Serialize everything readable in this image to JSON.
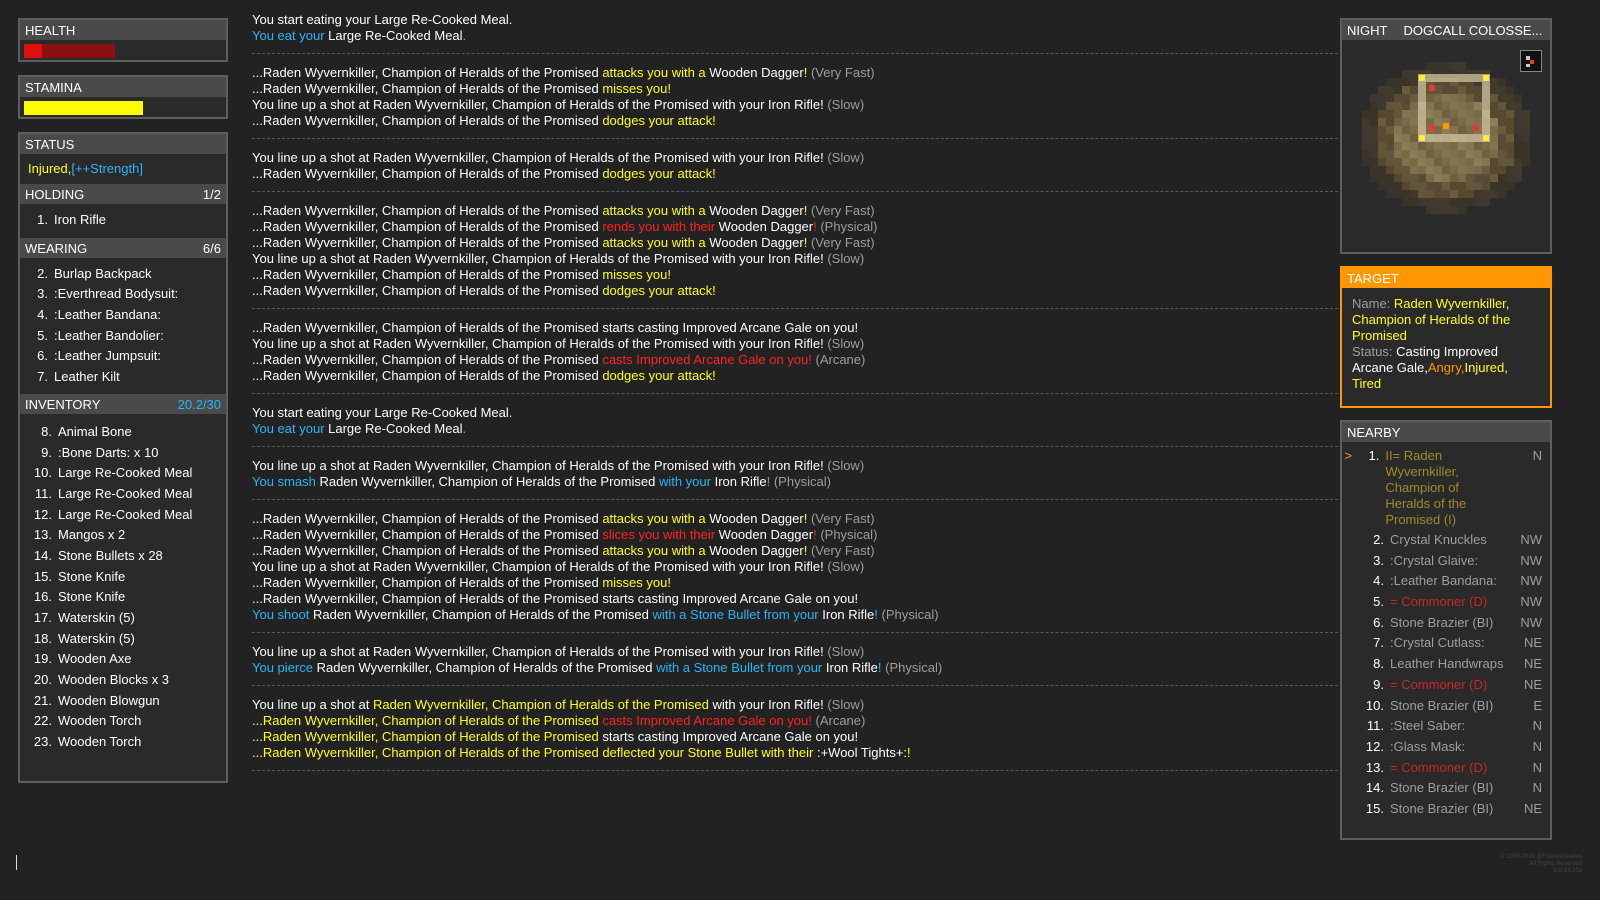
{
  "health": {
    "label": "HEALTH",
    "value": 0.09,
    "damage_shadow": 0.46
  },
  "stamina": {
    "label": "STAMINA",
    "value": 0.6
  },
  "status": {
    "label": "STATUS",
    "injured": "Injured,",
    "strength": "[++Strength]"
  },
  "holding": {
    "label": "HOLDING",
    "count": "1/2",
    "items": [
      {
        "n": "1.",
        "name": "Iron Rifle"
      }
    ]
  },
  "wearing": {
    "label": "WEARING",
    "count": "6/6",
    "items": [
      {
        "n": "2.",
        "name": "Burlap Backpack"
      },
      {
        "n": "3.",
        "name": ":Everthread Bodysuit:"
      },
      {
        "n": "4.",
        "name": ":Leather Bandana:"
      },
      {
        "n": "5.",
        "name": ":Leather Bandolier:"
      },
      {
        "n": "6.",
        "name": ":Leather Jumpsuit:"
      },
      {
        "n": "7.",
        "name": "Leather Kilt"
      }
    ]
  },
  "inventory": {
    "label": "INVENTORY",
    "count": "20.2/30",
    "items": [
      {
        "n": "8.",
        "name": "Animal Bone"
      },
      {
        "n": "9.",
        "name": ":Bone Darts: x 10"
      },
      {
        "n": "10.",
        "name": "Large Re-Cooked Meal"
      },
      {
        "n": "11.",
        "name": "Large Re-Cooked Meal"
      },
      {
        "n": "12.",
        "name": "Large Re-Cooked Meal"
      },
      {
        "n": "13.",
        "name": "Mangos x 2"
      },
      {
        "n": "14.",
        "name": "Stone Bullets x 28"
      },
      {
        "n": "15.",
        "name": "Stone Knife"
      },
      {
        "n": "16.",
        "name": "Stone Knife"
      },
      {
        "n": "17.",
        "name": "Waterskin (5)"
      },
      {
        "n": "18.",
        "name": "Waterskin (5)"
      },
      {
        "n": "19.",
        "name": "Wooden Axe"
      },
      {
        "n": "20.",
        "name": "Wooden Blocks x 3"
      },
      {
        "n": "21.",
        "name": "Wooden Blowgun"
      },
      {
        "n": "22.",
        "name": "Wooden Torch"
      },
      {
        "n": "23.",
        "name": "Wooden Torch"
      }
    ]
  },
  "log": [
    [
      [
        [
          "w",
          "You start eating your Large Re-Cooked Meal."
        ]
      ],
      [
        [
          "b",
          "You eat your "
        ],
        [
          "w",
          "Large Re-Cooked Meal"
        ],
        [
          "g",
          "."
        ]
      ]
    ],
    [
      [
        [
          "w",
          "...Raden Wyvernkiller, Champion of Heralds of the Promised "
        ],
        [
          "y",
          "attacks you with a "
        ],
        [
          "w",
          "Wooden Dagger"
        ],
        [
          "y",
          "!"
        ],
        [
          "g",
          " (Very Fast)"
        ]
      ],
      [
        [
          "w",
          "...Raden Wyvernkiller, Champion of Heralds of the Promised "
        ],
        [
          "y",
          "misses you!"
        ]
      ],
      [
        [
          "w",
          "You line up a shot at Raden Wyvernkiller, Champion of Heralds of the Promised with your Iron Rifle!"
        ],
        [
          "g",
          " (Slow)"
        ]
      ],
      [
        [
          "w",
          "...Raden Wyvernkiller, Champion of Heralds of the Promised "
        ],
        [
          "y",
          "dodges your attack!"
        ]
      ]
    ],
    [
      [
        [
          "w",
          "You line up a shot at Raden Wyvernkiller, Champion of Heralds of the Promised with your Iron Rifle!"
        ],
        [
          "g",
          " (Slow)"
        ]
      ],
      [
        [
          "w",
          "...Raden Wyvernkiller, Champion of Heralds of the Promised "
        ],
        [
          "y",
          "dodges your attack!"
        ]
      ]
    ],
    [
      [
        [
          "w",
          "...Raden Wyvernkiller, Champion of Heralds of the Promised "
        ],
        [
          "y",
          "attacks you with a "
        ],
        [
          "w",
          "Wooden Dagger"
        ],
        [
          "y",
          "!"
        ],
        [
          "g",
          " (Very Fast)"
        ]
      ],
      [
        [
          "w",
          "...Raden Wyvernkiller, Champion of Heralds of the Promised "
        ],
        [
          "r",
          "rends you with their "
        ],
        [
          "w",
          "Wooden Dagger"
        ],
        [
          "r",
          "!"
        ],
        [
          "g",
          " (Physical)"
        ]
      ],
      [
        [
          "w",
          "...Raden Wyvernkiller, Champion of Heralds of the Promised "
        ],
        [
          "y",
          "attacks you with a "
        ],
        [
          "w",
          "Wooden Dagger"
        ],
        [
          "y",
          "!"
        ],
        [
          "g",
          " (Very Fast)"
        ]
      ],
      [
        [
          "w",
          "You line up a shot at Raden Wyvernkiller, Champion of Heralds of the Promised with your Iron Rifle!"
        ],
        [
          "g",
          " (Slow)"
        ]
      ],
      [
        [
          "w",
          "...Raden Wyvernkiller, Champion of Heralds of the Promised "
        ],
        [
          "y",
          "misses you!"
        ]
      ],
      [
        [
          "w",
          "...Raden Wyvernkiller, Champion of Heralds of the Promised "
        ],
        [
          "y",
          "dodges your attack!"
        ]
      ]
    ],
    [
      [
        [
          "w",
          "...Raden Wyvernkiller, Champion of Heralds of the Promised starts casting Improved Arcane Gale on you!"
        ]
      ],
      [
        [
          "w",
          "You line up a shot at Raden Wyvernkiller, Champion of Heralds of the Promised with your Iron Rifle!"
        ],
        [
          "g",
          " (Slow)"
        ]
      ],
      [
        [
          "w",
          "...Raden Wyvernkiller, Champion of Heralds of the Promised "
        ],
        [
          "r",
          "casts Improved Arcane Gale on you!"
        ],
        [
          "g",
          " (Arcane)"
        ]
      ],
      [
        [
          "w",
          "...Raden Wyvernkiller, Champion of Heralds of the Promised "
        ],
        [
          "y",
          "dodges your attack!"
        ]
      ]
    ],
    [
      [
        [
          "w",
          "You start eating your Large Re-Cooked Meal."
        ]
      ],
      [
        [
          "b",
          "You eat your "
        ],
        [
          "w",
          "Large Re-Cooked Meal"
        ],
        [
          "g",
          "."
        ]
      ]
    ],
    [
      [
        [
          "w",
          "You line up a shot at Raden Wyvernkiller, Champion of Heralds of the Promised with your Iron Rifle!"
        ],
        [
          "g",
          " (Slow)"
        ]
      ],
      [
        [
          "b",
          "You smash "
        ],
        [
          "w",
          "Raden Wyvernkiller, Champion of Heralds of the Promised "
        ],
        [
          "b",
          "with your "
        ],
        [
          "w",
          "Iron Rifle"
        ],
        [
          "b",
          "!"
        ],
        [
          "g",
          " (Physical)"
        ]
      ]
    ],
    [
      [
        [
          "w",
          "...Raden Wyvernkiller, Champion of Heralds of the Promised "
        ],
        [
          "y",
          "attacks you with a "
        ],
        [
          "w",
          "Wooden Dagger"
        ],
        [
          "y",
          "!"
        ],
        [
          "g",
          " (Very Fast)"
        ]
      ],
      [
        [
          "w",
          "...Raden Wyvernkiller, Champion of Heralds of the Promised "
        ],
        [
          "r",
          "slices you with their "
        ],
        [
          "w",
          "Wooden Dagger"
        ],
        [
          "r",
          "!"
        ],
        [
          "g",
          " (Physical)"
        ]
      ],
      [
        [
          "w",
          "...Raden Wyvernkiller, Champion of Heralds of the Promised "
        ],
        [
          "y",
          "attacks you with a "
        ],
        [
          "w",
          "Wooden Dagger"
        ],
        [
          "y",
          "!"
        ],
        [
          "g",
          " (Very Fast)"
        ]
      ],
      [
        [
          "w",
          "You line up a shot at Raden Wyvernkiller, Champion of Heralds of the Promised with your Iron Rifle!"
        ],
        [
          "g",
          " (Slow)"
        ]
      ],
      [
        [
          "w",
          "...Raden Wyvernkiller, Champion of Heralds of the Promised "
        ],
        [
          "y",
          "misses you!"
        ]
      ],
      [
        [
          "w",
          "...Raden Wyvernkiller, Champion of Heralds of the Promised starts casting Improved Arcane Gale on you!"
        ]
      ],
      [
        [
          "b",
          "You shoot "
        ],
        [
          "w",
          "Raden Wyvernkiller, Champion of Heralds of the Promised "
        ],
        [
          "b",
          "with a Stone Bullet from your "
        ],
        [
          "w",
          "Iron Rifle"
        ],
        [
          "b",
          "!"
        ],
        [
          "g",
          " (Physical)"
        ]
      ]
    ],
    [
      [
        [
          "w",
          "You line up a shot at Raden Wyvernkiller, Champion of Heralds of the Promised with your Iron Rifle!"
        ],
        [
          "g",
          " (Slow)"
        ]
      ],
      [
        [
          "b",
          "You pierce "
        ],
        [
          "w",
          "Raden Wyvernkiller, Champion of Heralds of the Promised "
        ],
        [
          "b",
          "with a Stone Bullet from your "
        ],
        [
          "w",
          "Iron Rifle"
        ],
        [
          "b",
          "!"
        ],
        [
          "g",
          " (Physical)"
        ]
      ]
    ],
    [
      [
        [
          "w",
          "You line up a shot at "
        ],
        [
          "y",
          "Raden Wyvernkiller, Champion of Heralds of the Promised"
        ],
        [
          "w",
          " with your Iron Rifle!"
        ],
        [
          "g",
          " (Slow)"
        ]
      ],
      [
        [
          "y",
          "...Raden Wyvernkiller, Champion of Heralds of the Promised "
        ],
        [
          "r",
          "casts Improved Arcane Gale on you!"
        ],
        [
          "g",
          " (Arcane)"
        ]
      ],
      [
        [
          "y",
          "...Raden Wyvernkiller, Champion of Heralds of the Promised "
        ],
        [
          "w",
          "starts casting Improved Arcane Gale on you!"
        ]
      ],
      [
        [
          "y",
          "...Raden Wyvernkiller, Champion of Heralds of the Promised "
        ],
        [
          "y",
          "deflected your Stone Bullet with their "
        ],
        [
          "w",
          ":+Wool Tights+:"
        ],
        [
          "y",
          "!"
        ]
      ]
    ]
  ],
  "map": {
    "time": "NIGHT",
    "location": "DOGCALL COLOSSE..."
  },
  "target": {
    "label": "TARGET",
    "name_key": "Name:",
    "name_value": "Raden Wyvernkiller, Champion of Heralds of the Promised",
    "status_key": "Status:",
    "status_value": "Casting Improved Arcane Gale,",
    "angry": "Angry,",
    "injured": "Injured,",
    "tired": "Tired"
  },
  "nearby": {
    "label": "NEARBY",
    "items": [
      {
        "n": "1.",
        "name": "II= Raden Wyvernkiller, Champion of Heralds of the Promised (I)",
        "dir": "N",
        "selected": true,
        "color": "#a08a24"
      },
      {
        "n": "2.",
        "name": "Crystal Knuckles",
        "dir": "NW"
      },
      {
        "n": "3.",
        "name": ":Crystal Glaive:",
        "dir": "NW"
      },
      {
        "n": "4.",
        "name": ":Leather Bandana:",
        "dir": "NW"
      },
      {
        "n": "5.",
        "name": "= Commoner (D)",
        "dir": "NW",
        "color": "#c62828"
      },
      {
        "n": "6.",
        "name": "Stone Brazier (BI)",
        "dir": "NW"
      },
      {
        "n": "7.",
        "name": ":Crystal Cutlass:",
        "dir": "NE"
      },
      {
        "n": "8.",
        "name": "Leather Handwraps",
        "dir": "NE"
      },
      {
        "n": "9.",
        "name": "= Commoner (D)",
        "dir": "NE",
        "color": "#c62828"
      },
      {
        "n": "10.",
        "name": "Stone Brazier (BI)",
        "dir": "E"
      },
      {
        "n": "11.",
        "name": ":Steel Saber:",
        "dir": "N"
      },
      {
        "n": "12.",
        "name": ":Glass Mask:",
        "dir": "N"
      },
      {
        "n": "13.",
        "name": "= Commoner (D)",
        "dir": "N",
        "color": "#c62828"
      },
      {
        "n": "14.",
        "name": "Stone Brazier (BI)",
        "dir": "N"
      },
      {
        "n": "15.",
        "name": "Stone Brazier (BI)",
        "dir": "NE"
      }
    ]
  },
  "footer": {
    "copyright": "© 2008-2019 @FriendCreative",
    "rights": "All Rights Reserved",
    "version": "0.0.14.10a"
  },
  "colors": {
    "health": "#e01010",
    "health_shadow": "#8b1010",
    "stamina": "#ffff00",
    "target_header": "#ff9800",
    "accent_blue": "#29b6f6"
  }
}
